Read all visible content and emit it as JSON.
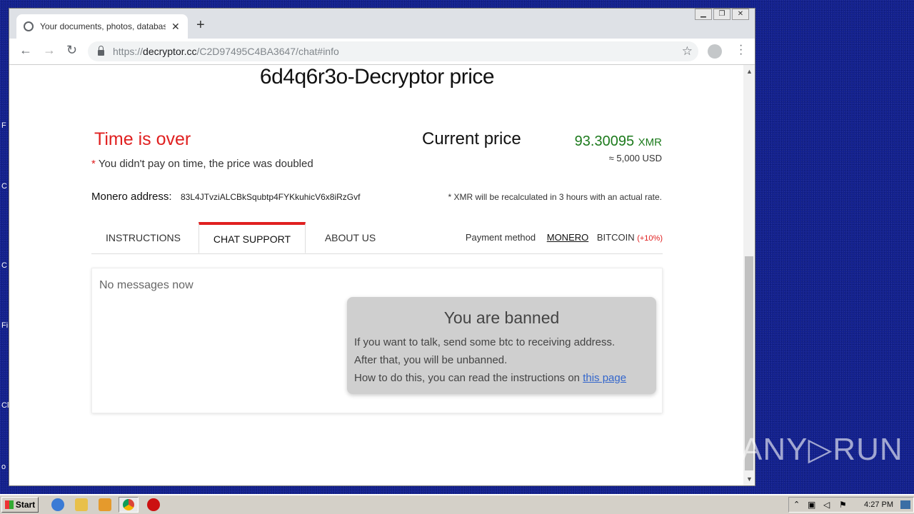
{
  "desktop": {
    "labels": [
      "F",
      "C",
      "C",
      "Fi",
      "Cl",
      "o"
    ]
  },
  "browser": {
    "tab_title": "Your documents, photos, databases",
    "tab_close": "✕",
    "new_tab": "+",
    "url_scheme": "https://",
    "url_host": "decryptor.cc",
    "url_path": "/C2D97495C4BA3647/chat#info",
    "window_controls": [
      "▁",
      "❐",
      "✕"
    ]
  },
  "page": {
    "title": "6d4q6r3o-Decryptor price",
    "time_over": "Time is over",
    "late_asterisk": "*",
    "late_note": "You didn't pay on time, the price was doubled",
    "current_price_label": "Current price",
    "price_xmr": "93.30095",
    "price_unit": "XMR",
    "price_usd": "≈ 5,000 USD",
    "monero_address_label": "Monero address:",
    "monero_address": "83L4JTvziALCBkSqubtp4FYKkuhicV6x8iRzGvf",
    "recalc_note": "* XMR will be recalculated in 3 hours with an actual rate.",
    "tabs": [
      {
        "label": "INSTRUCTIONS"
      },
      {
        "label": "CHAT SUPPORT"
      },
      {
        "label": "ABOUT US"
      }
    ],
    "payment_method_label": "Payment method",
    "payment_monero": "MONERO",
    "payment_bitcoin": "BITCOIN",
    "payment_bitcoin_extra": "(+10%)",
    "chat": {
      "empty": "No messages now",
      "banned_title": "You are banned",
      "banned_line1": "If you want to talk, send some btc to receiving address.",
      "banned_line2": "After that, you will be unbanned.",
      "banned_line3": "How to do this, you can read the instructions on",
      "banned_link": "this page"
    }
  },
  "watermark": "ANY▷RUN",
  "taskbar": {
    "start": "Start",
    "clock": "4:27 PM"
  },
  "colors": {
    "alert_red": "#e02020",
    "price_green": "#1c7a1c",
    "link_blue": "#3366cc",
    "desktop_blue": "#12208e"
  }
}
